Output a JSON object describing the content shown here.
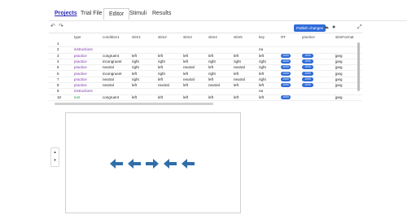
{
  "nav": {
    "tabs": [
      "Projects",
      "Trial File",
      "Editor",
      "Stimuli",
      "Results"
    ]
  },
  "toolbar": {
    "undo_icon": "undo-icon",
    "redo_icon": "redo-icon",
    "publish_label": "Publish changes",
    "expand_icon": "expand-icon"
  },
  "grid": {
    "headers": [
      "type",
      "condition1",
      "stim1",
      "stim2",
      "stim3",
      "stim4",
      "stim5",
      "key",
      "RT",
      "practice",
      "stimFormat"
    ],
    "rows": [
      {
        "n": "1",
        "type": "",
        "cells": [
          "",
          "",
          "",
          "",
          "",
          "",
          "",
          "",
          "",
          "",
          ""
        ]
      },
      {
        "n": "2",
        "type": "instructions",
        "cells": [
          "",
          "",
          "",
          "",
          "",
          "",
          "na",
          "",
          "",
          ""
        ]
      },
      {
        "n": "3",
        "type": "practice",
        "cells": [
          "congruent",
          "left",
          "left",
          "left",
          "left",
          "left",
          "left",
          "1000",
          "1000",
          "jpeg"
        ]
      },
      {
        "n": "4",
        "type": "practice",
        "cells": [
          "incongruent",
          "right",
          "right",
          "left",
          "right",
          "right",
          "right",
          "1000",
          "1000",
          "jpeg"
        ]
      },
      {
        "n": "5",
        "type": "practice",
        "cells": [
          "neutral",
          "right",
          "left",
          "neutral",
          "left",
          "neutral",
          "right",
          "1000",
          "1000",
          "jpeg"
        ]
      },
      {
        "n": "6",
        "type": "practice",
        "cells": [
          "incongruent",
          "left",
          "right",
          "left",
          "right",
          "left",
          "left",
          "1000",
          "1000",
          "jpeg"
        ]
      },
      {
        "n": "7",
        "type": "practice",
        "cells": [
          "neutral",
          "right",
          "left",
          "neutral",
          "left",
          "neutral",
          "right",
          "1000",
          "1000",
          "jpeg"
        ]
      },
      {
        "n": "8",
        "type": "practice",
        "cells": [
          "neutral",
          "left",
          "neutral",
          "left",
          "neutral",
          "left",
          "left",
          "1000",
          "1000",
          "jpeg"
        ]
      },
      {
        "n": "9",
        "type": "instructions",
        "cells": [
          "",
          "",
          "",
          "",
          "",
          "",
          "na",
          "",
          "",
          ""
        ]
      },
      {
        "n": "10",
        "type": "test",
        "cells": [
          "congruent",
          "left",
          "left",
          "left",
          "left",
          "left",
          "left",
          "1000",
          "",
          "jpeg"
        ]
      }
    ]
  },
  "preview": {
    "arrows": [
      "left",
      "left",
      "right",
      "left",
      "left"
    ],
    "arrow_color": "#2f6ea8"
  }
}
